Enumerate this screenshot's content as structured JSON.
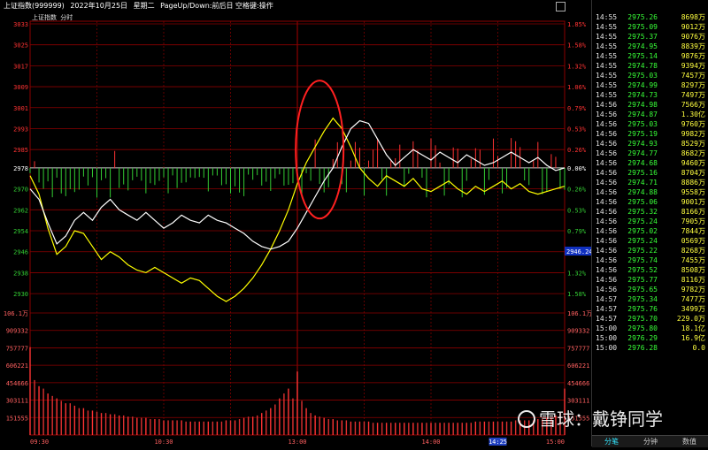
{
  "titlebar": {
    "index_name": "上证指数(999999)",
    "date": "2022年10月25日",
    "weekday": "星期二",
    "hint": "PageUp/Down:前后日 空格键:操作"
  },
  "chart_header": {
    "name": "上证指数",
    "mode": "分时"
  },
  "colors": {
    "up": "#ff3333",
    "down": "#33cc33",
    "grid": "#8b0000",
    "price_line": "#ffffff",
    "avg_line": "#ffff00",
    "highlight": "#ff2020"
  },
  "chart_data": {
    "type": "line",
    "ylim": [
      2926,
      3034
    ],
    "pre_close": 2978,
    "left_ticks": [
      "3033",
      "3025",
      "3017",
      "3009",
      "3001",
      "2993",
      "2985",
      "2978",
      "2970",
      "2962",
      "2954",
      "2946",
      "2938",
      "2930"
    ],
    "right_ticks": [
      "1.85%",
      "1.58%",
      "1.32%",
      "1.06%",
      "0.79%",
      "0.53%",
      "0.26%",
      "0.00%",
      "0.26%",
      "0.53%",
      "0.79%",
      "1.06%",
      "1.32%",
      "1.58%"
    ],
    "x_ticks": [
      "09:30",
      "10:30",
      "13:00",
      "14:00",
      "14:25",
      "15:00"
    ],
    "cursor_price": "2946.24",
    "price_series": [
      [
        0,
        2970
      ],
      [
        4,
        2966
      ],
      [
        8,
        2957
      ],
      [
        12,
        2949
      ],
      [
        16,
        2952
      ],
      [
        20,
        2958
      ],
      [
        24,
        2961
      ],
      [
        28,
        2958
      ],
      [
        32,
        2963
      ],
      [
        36,
        2966
      ],
      [
        40,
        2962
      ],
      [
        44,
        2960
      ],
      [
        48,
        2958
      ],
      [
        52,
        2961
      ],
      [
        56,
        2958
      ],
      [
        60,
        2955
      ],
      [
        64,
        2957
      ],
      [
        68,
        2960
      ],
      [
        72,
        2958
      ],
      [
        76,
        2957
      ],
      [
        80,
        2960
      ],
      [
        84,
        2958
      ],
      [
        88,
        2957
      ],
      [
        92,
        2955
      ],
      [
        96,
        2953
      ],
      [
        100,
        2950
      ],
      [
        104,
        2948
      ],
      [
        108,
        2947
      ],
      [
        112,
        2948
      ],
      [
        116,
        2950
      ],
      [
        120,
        2955
      ],
      [
        124,
        2961
      ],
      [
        128,
        2967
      ],
      [
        132,
        2973
      ],
      [
        136,
        2978
      ],
      [
        140,
        2986
      ],
      [
        144,
        2993
      ],
      [
        148,
        2996
      ],
      [
        152,
        2995
      ],
      [
        156,
        2989
      ],
      [
        160,
        2983
      ],
      [
        164,
        2979
      ],
      [
        168,
        2982
      ],
      [
        172,
        2985
      ],
      [
        176,
        2983
      ],
      [
        180,
        2981
      ],
      [
        184,
        2984
      ],
      [
        188,
        2982
      ],
      [
        192,
        2980
      ],
      [
        196,
        2983
      ],
      [
        200,
        2981
      ],
      [
        204,
        2979
      ],
      [
        208,
        2980
      ],
      [
        212,
        2982
      ],
      [
        216,
        2984
      ],
      [
        220,
        2982
      ],
      [
        224,
        2980
      ],
      [
        228,
        2982
      ],
      [
        232,
        2979
      ],
      [
        236,
        2977
      ],
      [
        240,
        2978
      ]
    ],
    "avg_series": [
      [
        0,
        2975
      ],
      [
        4,
        2968
      ],
      [
        8,
        2955
      ],
      [
        12,
        2945
      ],
      [
        16,
        2948
      ],
      [
        20,
        2954
      ],
      [
        24,
        2953
      ],
      [
        28,
        2948
      ],
      [
        32,
        2943
      ],
      [
        36,
        2946
      ],
      [
        40,
        2944
      ],
      [
        44,
        2941
      ],
      [
        48,
        2939
      ],
      [
        52,
        2938
      ],
      [
        56,
        2940
      ],
      [
        60,
        2938
      ],
      [
        64,
        2936
      ],
      [
        68,
        2934
      ],
      [
        72,
        2936
      ],
      [
        76,
        2935
      ],
      [
        80,
        2932
      ],
      [
        84,
        2929
      ],
      [
        88,
        2927
      ],
      [
        92,
        2929
      ],
      [
        96,
        2932
      ],
      [
        100,
        2936
      ],
      [
        104,
        2941
      ],
      [
        108,
        2947
      ],
      [
        112,
        2954
      ],
      [
        116,
        2962
      ],
      [
        120,
        2972
      ],
      [
        124,
        2980
      ],
      [
        128,
        2986
      ],
      [
        132,
        2992
      ],
      [
        136,
        2997
      ],
      [
        140,
        2993
      ],
      [
        144,
        2986
      ],
      [
        148,
        2978
      ],
      [
        152,
        2974
      ],
      [
        156,
        2971
      ],
      [
        160,
        2975
      ],
      [
        164,
        2973
      ],
      [
        168,
        2971
      ],
      [
        172,
        2974
      ],
      [
        176,
        2970
      ],
      [
        180,
        2969
      ],
      [
        184,
        2971
      ],
      [
        188,
        2973
      ],
      [
        192,
        2970
      ],
      [
        196,
        2968
      ],
      [
        200,
        2971
      ],
      [
        204,
        2969
      ],
      [
        208,
        2971
      ],
      [
        212,
        2973
      ],
      [
        216,
        2970
      ],
      [
        220,
        2972
      ],
      [
        224,
        2969
      ],
      [
        228,
        2968
      ],
      [
        232,
        2969
      ],
      [
        236,
        2970
      ],
      [
        240,
        2971
      ]
    ],
    "volume_ticks": [
      "106.1万",
      "909332",
      "757777",
      "606221",
      "454666",
      "303111",
      "151555"
    ],
    "volume_right_ticks": [
      "106.1万",
      "909332",
      "757777",
      "606221",
      "454666",
      "303111",
      "151555"
    ],
    "volume": [
      [
        0,
        72
      ],
      [
        2,
        45
      ],
      [
        4,
        40
      ],
      [
        6,
        38
      ],
      [
        8,
        34
      ],
      [
        10,
        32
      ],
      [
        12,
        30
      ],
      [
        14,
        28
      ],
      [
        16,
        26
      ],
      [
        18,
        26
      ],
      [
        20,
        24
      ],
      [
        22,
        22
      ],
      [
        24,
        22
      ],
      [
        26,
        20
      ],
      [
        28,
        20
      ],
      [
        30,
        19
      ],
      [
        32,
        18
      ],
      [
        34,
        18
      ],
      [
        36,
        17
      ],
      [
        38,
        17
      ],
      [
        40,
        16
      ],
      [
        42,
        16
      ],
      [
        44,
        15
      ],
      [
        46,
        15
      ],
      [
        48,
        14
      ],
      [
        50,
        14
      ],
      [
        52,
        14
      ],
      [
        54,
        13
      ],
      [
        56,
        13
      ],
      [
        58,
        13
      ],
      [
        60,
        12
      ],
      [
        62,
        12
      ],
      [
        64,
        12
      ],
      [
        66,
        12
      ],
      [
        68,
        12
      ],
      [
        70,
        11
      ],
      [
        72,
        11
      ],
      [
        74,
        11
      ],
      [
        76,
        11
      ],
      [
        78,
        11
      ],
      [
        80,
        11
      ],
      [
        82,
        11
      ],
      [
        84,
        11
      ],
      [
        86,
        11
      ],
      [
        88,
        12
      ],
      [
        90,
        12
      ],
      [
        92,
        12
      ],
      [
        94,
        13
      ],
      [
        96,
        14
      ],
      [
        98,
        15
      ],
      [
        100,
        15
      ],
      [
        102,
        16
      ],
      [
        104,
        18
      ],
      [
        106,
        20
      ],
      [
        108,
        22
      ],
      [
        110,
        25
      ],
      [
        112,
        30
      ],
      [
        114,
        34
      ],
      [
        116,
        38
      ],
      [
        118,
        30
      ],
      [
        120,
        52
      ],
      [
        122,
        28
      ],
      [
        124,
        22
      ],
      [
        126,
        18
      ],
      [
        128,
        16
      ],
      [
        130,
        15
      ],
      [
        132,
        14
      ],
      [
        134,
        13
      ],
      [
        136,
        13
      ],
      [
        138,
        12
      ],
      [
        140,
        12
      ],
      [
        142,
        12
      ],
      [
        144,
        11
      ],
      [
        146,
        11
      ],
      [
        148,
        11
      ],
      [
        150,
        11
      ],
      [
        152,
        11
      ],
      [
        154,
        10
      ],
      [
        156,
        10
      ],
      [
        158,
        10
      ],
      [
        160,
        10
      ],
      [
        162,
        10
      ],
      [
        164,
        10
      ],
      [
        166,
        10
      ],
      [
        168,
        10
      ],
      [
        170,
        10
      ],
      [
        172,
        10
      ],
      [
        174,
        10
      ],
      [
        176,
        10
      ],
      [
        178,
        10
      ],
      [
        180,
        10
      ],
      [
        182,
        10
      ],
      [
        184,
        10
      ],
      [
        186,
        10
      ],
      [
        188,
        10
      ],
      [
        190,
        10
      ],
      [
        192,
        10
      ],
      [
        194,
        10
      ],
      [
        196,
        10
      ],
      [
        198,
        10
      ],
      [
        200,
        11
      ],
      [
        202,
        11
      ],
      [
        204,
        11
      ],
      [
        206,
        11
      ],
      [
        208,
        11
      ],
      [
        210,
        11
      ],
      [
        212,
        11
      ],
      [
        214,
        11
      ],
      [
        216,
        11
      ],
      [
        218,
        12
      ],
      [
        220,
        12
      ],
      [
        222,
        12
      ],
      [
        224,
        12
      ],
      [
        226,
        12
      ],
      [
        228,
        13
      ],
      [
        230,
        13
      ],
      [
        232,
        14
      ],
      [
        234,
        14
      ],
      [
        236,
        16
      ],
      [
        238,
        18
      ],
      [
        240,
        38
      ]
    ],
    "volume_max": 100
  },
  "ticks_panel": [
    {
      "time": "14:55",
      "price": "2975.26",
      "vol": "8698万"
    },
    {
      "time": "14:55",
      "price": "2975.09",
      "vol": "9012万"
    },
    {
      "time": "14:55",
      "price": "2975.37",
      "vol": "9076万"
    },
    {
      "time": "14:55",
      "price": "2974.95",
      "vol": "8839万"
    },
    {
      "time": "14:55",
      "price": "2975.14",
      "vol": "9876万"
    },
    {
      "time": "14:55",
      "price": "2974.78",
      "vol": "9394万"
    },
    {
      "time": "14:55",
      "price": "2975.03",
      "vol": "7457万"
    },
    {
      "time": "14:55",
      "price": "2974.99",
      "vol": "8297万"
    },
    {
      "time": "14:55",
      "price": "2974.73",
      "vol": "7497万"
    },
    {
      "time": "14:56",
      "price": "2974.98",
      "vol": "7566万"
    },
    {
      "time": "14:56",
      "price": "2974.87",
      "vol": "1.30亿"
    },
    {
      "time": "14:56",
      "price": "2975.03",
      "vol": "9760万"
    },
    {
      "time": "14:56",
      "price": "2975.19",
      "vol": "9982万"
    },
    {
      "time": "14:56",
      "price": "2974.93",
      "vol": "8529万"
    },
    {
      "time": "14:56",
      "price": "2974.77",
      "vol": "8682万"
    },
    {
      "time": "14:56",
      "price": "2974.68",
      "vol": "9460万"
    },
    {
      "time": "14:56",
      "price": "2975.16",
      "vol": "8704万"
    },
    {
      "time": "14:56",
      "price": "2974.71",
      "vol": "8886万"
    },
    {
      "time": "14:56",
      "price": "2974.88",
      "vol": "9558万"
    },
    {
      "time": "14:56",
      "price": "2975.06",
      "vol": "9001万"
    },
    {
      "time": "14:56",
      "price": "2975.32",
      "vol": "8166万"
    },
    {
      "time": "14:56",
      "price": "2975.24",
      "vol": "7905万"
    },
    {
      "time": "14:56",
      "price": "2975.02",
      "vol": "7844万"
    },
    {
      "time": "14:56",
      "price": "2975.24",
      "vol": "0569万"
    },
    {
      "time": "14:56",
      "price": "2975.22",
      "vol": "8268万"
    },
    {
      "time": "14:56",
      "price": "2975.74",
      "vol": "7455万"
    },
    {
      "time": "14:56",
      "price": "2975.52",
      "vol": "8508万"
    },
    {
      "time": "14:56",
      "price": "2975.77",
      "vol": "8116万"
    },
    {
      "time": "14:56",
      "price": "2975.65",
      "vol": "9782万"
    },
    {
      "time": "14:57",
      "price": "2975.34",
      "vol": "7477万"
    },
    {
      "time": "14:57",
      "price": "2975.76",
      "vol": "3499万"
    },
    {
      "time": "14:57",
      "price": "2975.70",
      "vol": "229.0万"
    },
    {
      "time": "15:00",
      "price": "2975.80",
      "vol": "18.1亿"
    },
    {
      "time": "15:00",
      "price": "2976.29",
      "vol": "16.9亿"
    },
    {
      "time": "15:00",
      "price": "2976.28",
      "vol": "0.0"
    }
  ],
  "tabs": [
    {
      "label": "分笔",
      "active": true
    },
    {
      "label": "分钟",
      "active": false
    },
    {
      "label": "数值",
      "active": false
    }
  ],
  "watermark": {
    "logo_icon": "snowball-logo-icon",
    "text": "雪球：戴铮同学"
  }
}
